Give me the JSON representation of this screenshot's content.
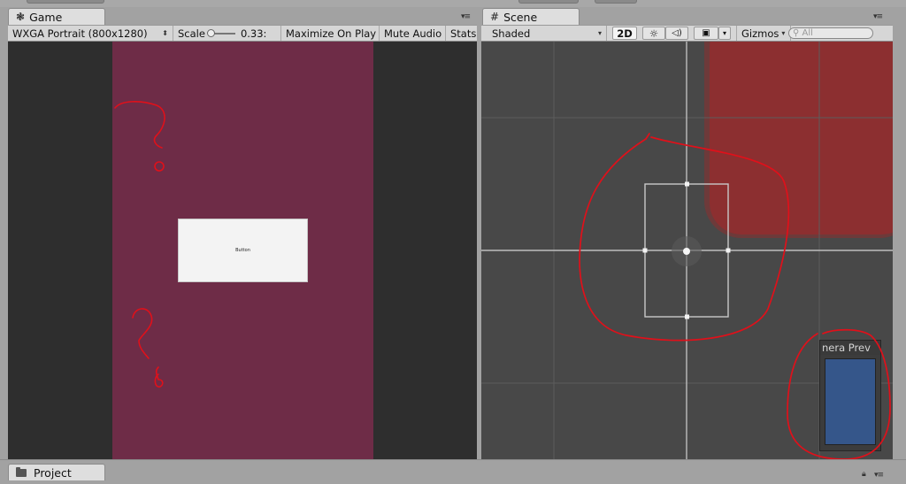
{
  "game": {
    "tab_label": "Game",
    "resolution": "WXGA Portrait (800x1280)",
    "scale_label": "Scale",
    "scale_value": "0.33:",
    "scale_slider_fraction": 0.05,
    "maximize_label": "Maximize On Play",
    "mute_label": "Mute Audio",
    "stats_label": "Stats",
    "button_text": "Button",
    "bg_color": "#2e2e2e",
    "canvas_color": "#6e2c47"
  },
  "scene": {
    "tab_label": "Scene",
    "shading_mode": "Shaded",
    "mode_2d_label": "2D",
    "gizmos_label": "Gizmos",
    "search_placeholder": "All",
    "camera_preview_title": "nera Prev",
    "camera_preview_color": "#35568a",
    "red_sprite_color": "#8c2f30"
  },
  "project": {
    "tab_label": "Project"
  },
  "icons": {
    "game_tab": "unity-logo-icon",
    "scene_tab": "grid-icon",
    "lighting": "sun-icon",
    "audio": "speaker-icon",
    "effects": "image-icon",
    "project_tab": "folder-icon"
  },
  "annotation_color": "#e0101a"
}
